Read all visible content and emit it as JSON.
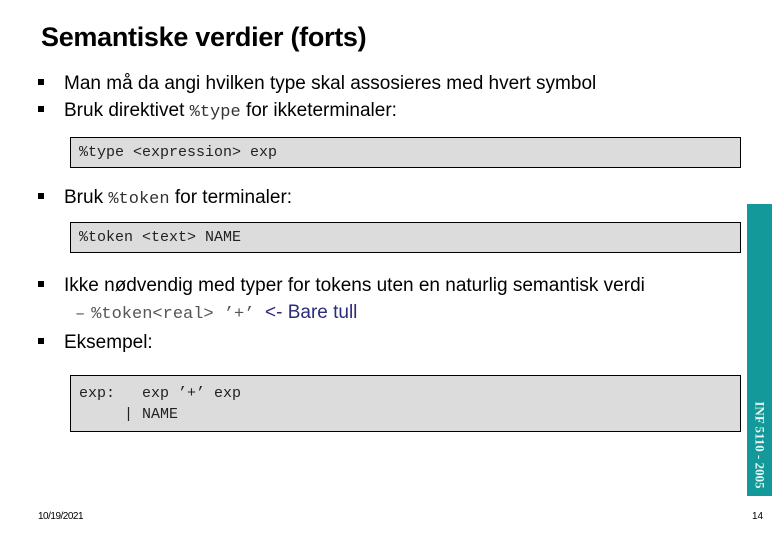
{
  "slide": {
    "title": "Semantiske verdier (forts)",
    "bullets": [
      {
        "text": "Man må da angi hvilken type skal assosieres med hvert symbol"
      },
      {
        "prefix": "Bruk direktivet ",
        "code": "%type",
        "suffix": " for ikketerminaler:"
      },
      {
        "prefix": "Bruk ",
        "code": "%token",
        "suffix": " for terminaler:"
      },
      {
        "text": "Ikke nødvendig med typer for tokens uten en naturlig semantisk verdi"
      },
      {
        "text": "Eksempel:"
      }
    ],
    "sub_bullet": {
      "dash": "–",
      "code": "%token<real> ’+’",
      "note": "<- Bare tull"
    },
    "code_blocks": {
      "type_decl": "%type <expression> exp",
      "token_decl": "%token <text> NAME",
      "grammar": "exp:   exp ’+’ exp\n     | NAME"
    },
    "side_label": "INF 5110 - 2005",
    "footer": {
      "date": "10/19/2021",
      "page": "14"
    }
  },
  "colors": {
    "accent_bar": "#139999",
    "code_bg": "#dcdcdc",
    "note_text": "#2b2b7a"
  }
}
